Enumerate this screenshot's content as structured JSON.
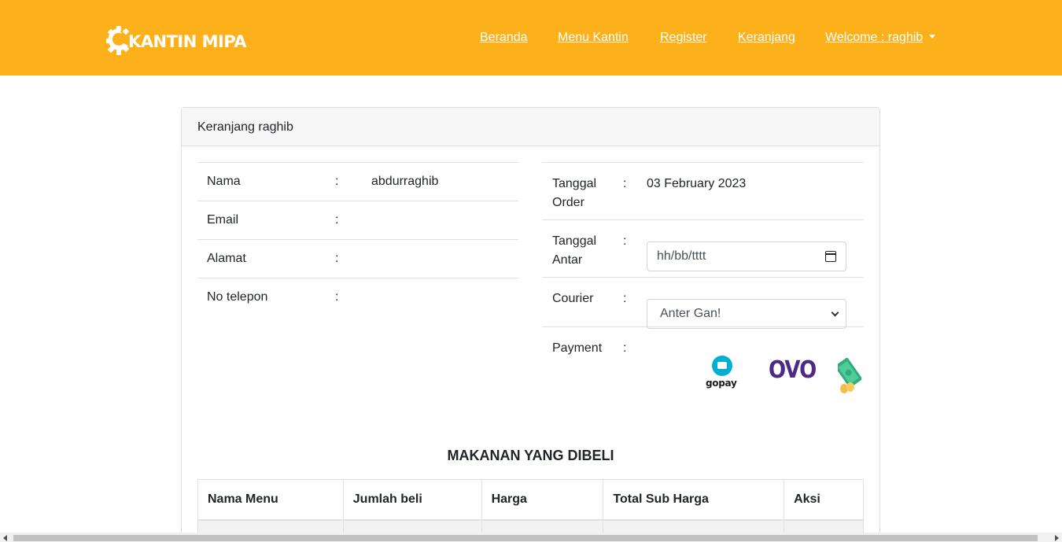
{
  "brand": {
    "name": "KANTIN MIPA",
    "logo_icon": "gear-c-logo-icon"
  },
  "nav": {
    "items": [
      {
        "label": "Beranda"
      },
      {
        "label": "Menu Kantin"
      },
      {
        "label": "Register"
      },
      {
        "label": "Keranjang"
      },
      {
        "label": "Welcome : raghib"
      }
    ]
  },
  "card": {
    "header": "Keranjang raghib"
  },
  "customer": {
    "rows": [
      {
        "label": "Nama",
        "colon": ":",
        "value": "abdurraghib"
      },
      {
        "label": "Email",
        "colon": ":",
        "value": ""
      },
      {
        "label": "Alamat",
        "colon": ":",
        "value": ""
      },
      {
        "label": "No telepon",
        "colon": ":",
        "value": ""
      }
    ]
  },
  "order": {
    "tanggal_order_label": "Tanggal Order",
    "tanggal_order_value": "03 February 2023",
    "tanggal_antar_label": "Tanggal Antar",
    "tanggal_antar_placeholder": "hh/bb/tttt",
    "courier_label": "Courier",
    "courier_selected": "Anter Gan!",
    "payment_label": "Payment",
    "colon": ":",
    "payment_options": {
      "gopay_text": "gopay",
      "ovo_text": "OVO"
    }
  },
  "purchased": {
    "title": "MAKANAN YANG DIBELI",
    "columns": [
      "Nama Menu",
      "Jumlah beli",
      "Harga",
      "Total Sub Harga",
      "Aksi"
    ]
  },
  "colors": {
    "navbar": "#fcb11b",
    "accent_button": "#fd7e14"
  }
}
